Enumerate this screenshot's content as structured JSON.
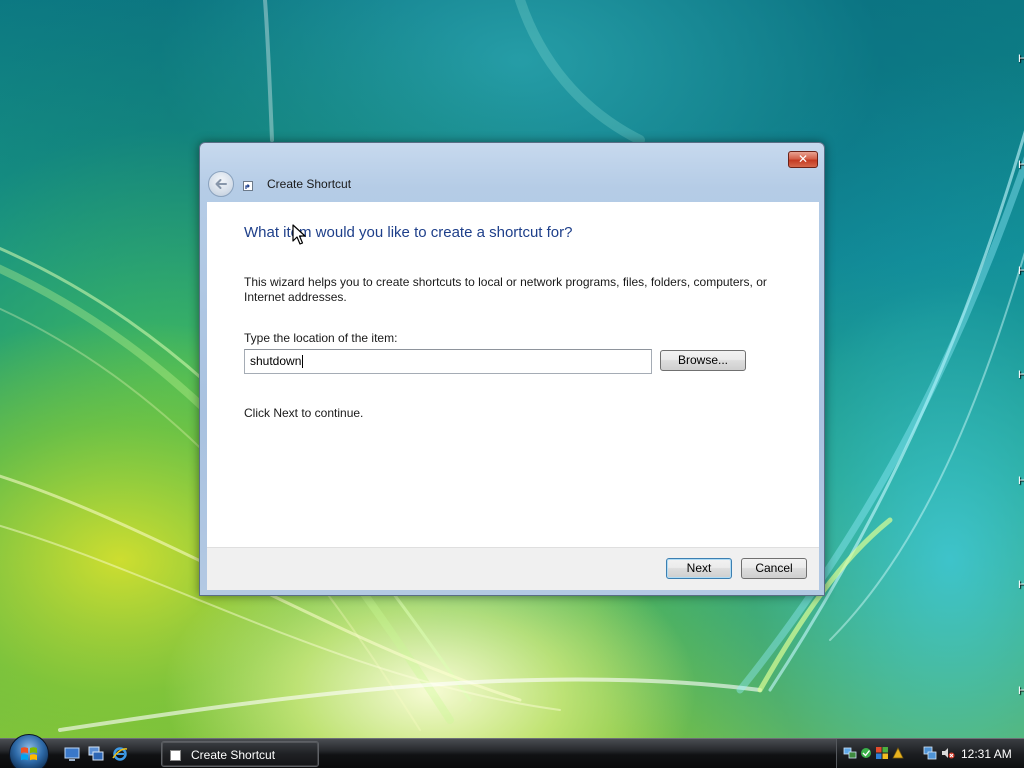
{
  "dialog": {
    "title": "Create Shortcut",
    "close_label": "✕",
    "main_instruction": "What item would you like to create a shortcut for?",
    "description": "This wizard helps you to create shortcuts to local or network programs, files, folders, computers, or Internet addresses.",
    "location_label": "Type the location of the item:",
    "location_value": "shutdown",
    "browse_label": "Browse...",
    "continue_text": "Click Next to continue.",
    "next_label": "Next",
    "cancel_label": "Cancel"
  },
  "taskbar": {
    "start_icon": "windows-start-orb-icon",
    "quick_launch": [
      "show-desktop-icon",
      "switch-windows-icon",
      "internet-explorer-icon"
    ],
    "open_window_label": "Create Shortcut",
    "tray_icons": [
      "network-icon",
      "device-icon",
      "security-icon",
      "tray-app-icon",
      "network-connection-icon",
      "volume-muted-icon"
    ],
    "clock": "12:31 AM"
  },
  "desktop": {
    "edge_icon_letters": [
      "H",
      "H",
      "H",
      "H",
      "H",
      "H",
      "H"
    ]
  },
  "colors": {
    "instruction_blue": "#1e3f8a",
    "close_red": "#c43b22",
    "default_button_border": "#3c7fb1"
  }
}
